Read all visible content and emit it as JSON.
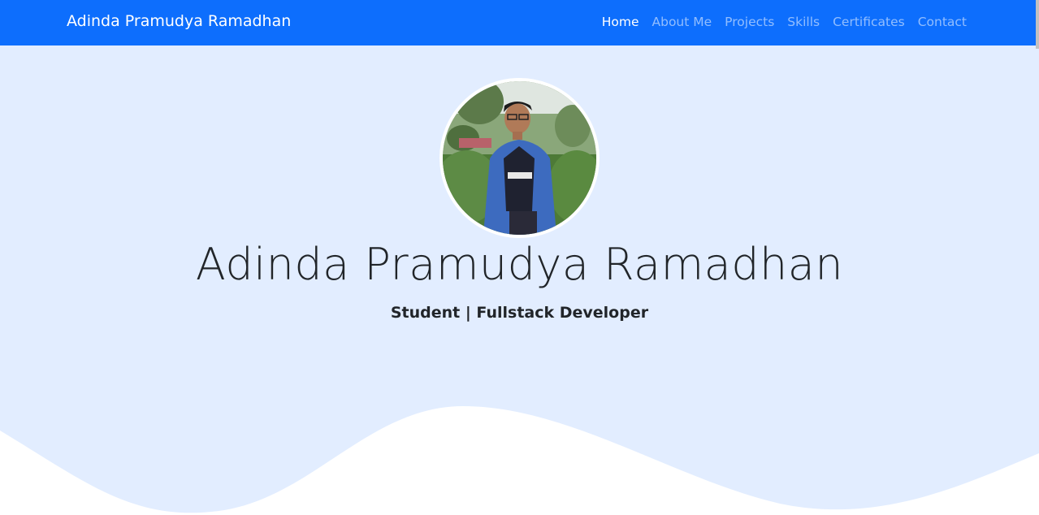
{
  "navbar": {
    "brand": "Adinda Pramudya Ramadhan",
    "items": [
      {
        "label": "Home",
        "active": true
      },
      {
        "label": "About Me",
        "active": false
      },
      {
        "label": "Projects",
        "active": false
      },
      {
        "label": "Skills",
        "active": false
      },
      {
        "label": "Certificates",
        "active": false
      },
      {
        "label": "Contact",
        "active": false
      }
    ]
  },
  "hero": {
    "name": "Adinda Pramudya Ramadhan",
    "tagline": "Student | Fullstack Developer",
    "photo_icon": "profile-photo"
  },
  "colors": {
    "navbar_bg": "#0d6efd",
    "hero_bg": "#e2edff",
    "text": "#212529"
  }
}
